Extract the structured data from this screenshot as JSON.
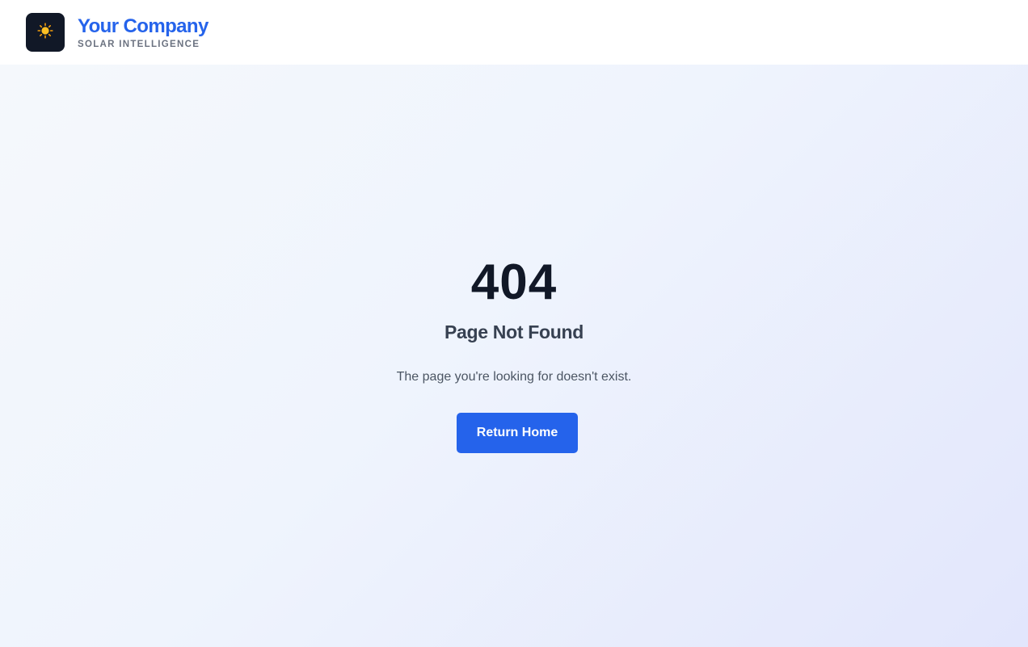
{
  "header": {
    "logo_icon": "sun-icon",
    "brand_name": "Your Company",
    "brand_tagline": "SOLAR INTELLIGENCE"
  },
  "error": {
    "code": "404",
    "title": "Page Not Found",
    "message": "The page you're looking for doesn't exist.",
    "button_label": "Return Home"
  },
  "colors": {
    "brand_blue": "#2563eb",
    "logo_background": "#111827",
    "heading_dark": "#111827",
    "subheading": "#374151",
    "body_text": "#4b5563",
    "sun_yellow": "#fbbf24"
  }
}
